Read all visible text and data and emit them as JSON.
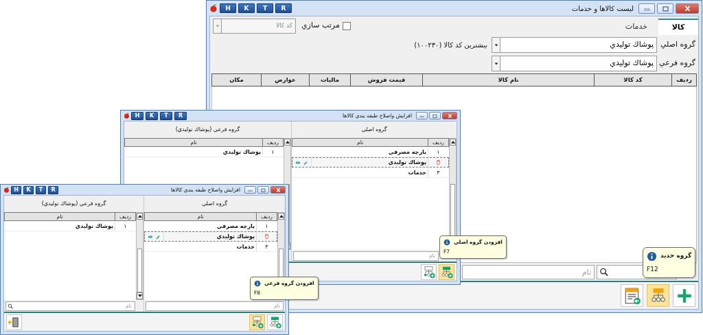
{
  "main_window": {
    "title": "ليست كالاها و خدمات",
    "title_buttons": [
      "R",
      "T",
      "K",
      "H"
    ],
    "tabs": [
      {
        "label": "كالا",
        "selected": true
      },
      {
        "label": "خدمات",
        "selected": false
      }
    ],
    "sort": {
      "label": "مرتب سازي",
      "checked": false
    },
    "code_select": {
      "placeholder": "كد كالا"
    },
    "fields": [
      {
        "label": "گروه اصلي",
        "value": "پوشاك توليدي"
      },
      {
        "label": "گروه فرعي",
        "value": "پوشاك توليدي"
      }
    ],
    "max_code": "بيشترين كد كالا (۱۰۰۲۳۰)",
    "table": {
      "columns": [
        "رديف",
        "كد كالا",
        "نام كالا",
        "قيمت فروش",
        "ماليات",
        "عوارض",
        "مكان"
      ]
    },
    "search": {
      "placeholder": "نام"
    },
    "toolbar": [
      {
        "kind": "add",
        "highlighted": false
      },
      {
        "kind": "add-group",
        "highlighted": true
      },
      {
        "kind": "report",
        "highlighted": false
      }
    ],
    "tooltip": {
      "title": "گروه جديد",
      "shortcut": "F12"
    }
  },
  "group_windows": [
    {
      "title": "افزايش واصلاح طبقه بندي كالاها",
      "title_buttons": [
        "R",
        "T",
        "K",
        "H"
      ],
      "panes": [
        {
          "title": "گروه اصلي",
          "columns": [
            "رديف",
            "نام"
          ],
          "rows": [
            {
              "number": "۱",
              "name": "پارچه مصرفي",
              "selected": false
            },
            {
              "name": "پوشاك توليدي",
              "selected": true
            },
            {
              "number": "۳",
              "name": "خدمات",
              "selected": false
            }
          ],
          "search": {
            "placeholder": "نام",
            "icon": false
          }
        },
        {
          "title": "گروه فرعي (پوشاك توليدي)",
          "columns": [
            "رديف",
            "نام"
          ],
          "rows": [
            {
              "number": "۱",
              "name": "پوشاك توليدي",
              "selected": false
            }
          ]
        }
      ],
      "toolbar": [
        {
          "kind": "add-main",
          "highlighted": true
        },
        {
          "kind": "add-sub",
          "highlighted": false
        }
      ],
      "tooltip": {
        "title": "افزودن گروه اصلي",
        "shortcut": "F7"
      }
    },
    {
      "title": "افزايش واصلاح طبقه بندي كالاها",
      "title_buttons": [
        "R",
        "T",
        "K",
        "H"
      ],
      "panes": [
        {
          "title": "گروه اصلي",
          "columns": [
            "رديف",
            "نام"
          ],
          "rows": [
            {
              "number": "۱",
              "name": "پارچه مصرفي",
              "selected": false
            },
            {
              "name": "پوشاك توليدي",
              "selected": true
            },
            {
              "number": "۳",
              "name": "خدمات",
              "selected": false
            }
          ],
          "search": {
            "placeholder": "نام",
            "icon": false
          }
        },
        {
          "title": "گروه فرعي (پوشاك توليدي)",
          "columns": [
            "رديف",
            "نام"
          ],
          "rows": [
            {
              "number": "۱",
              "name": "پوشاك توليدي",
              "selected": false
            }
          ],
          "search": {
            "placeholder": "نام",
            "icon": true
          }
        }
      ],
      "toolbar": [
        {
          "kind": "add-main",
          "highlighted": false
        },
        {
          "kind": "add-sub",
          "highlighted": true
        },
        {
          "kind": "exit",
          "highlighted": false
        }
      ],
      "tooltip": {
        "title": "افزودن گروه فرعي",
        "shortcut": "F8"
      }
    }
  ]
}
